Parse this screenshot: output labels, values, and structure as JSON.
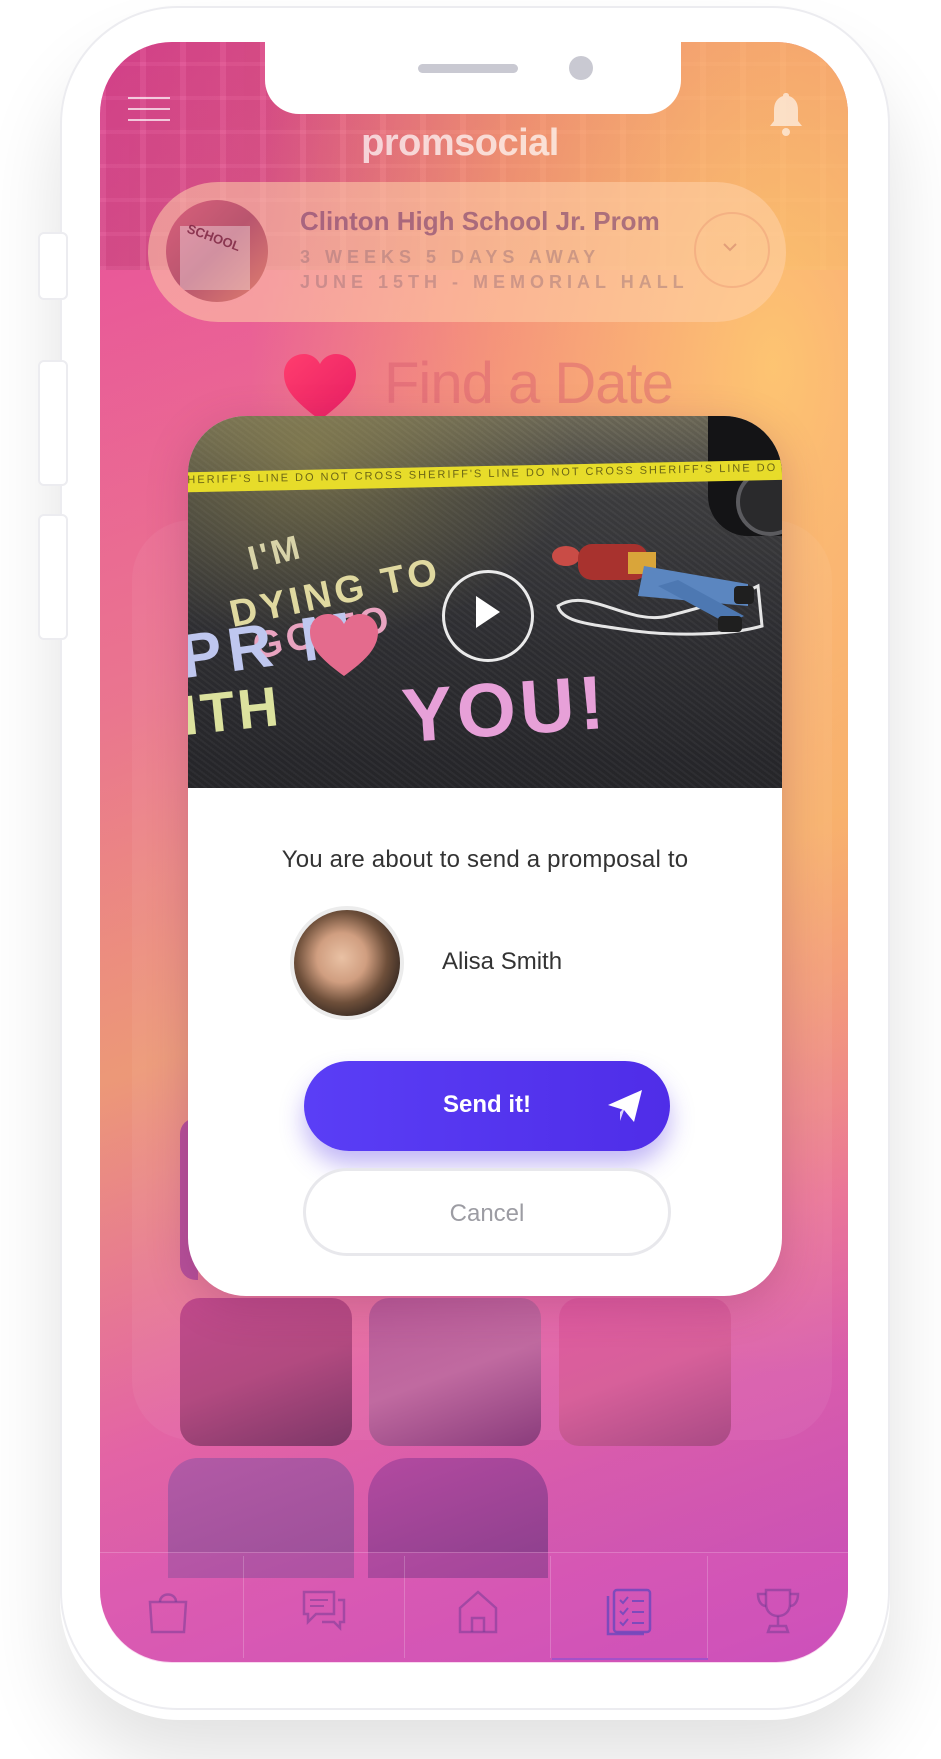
{
  "app": {
    "logo_text": "promsocial"
  },
  "event": {
    "title": "Clinton High School Jr. Prom",
    "countdown": "3 WEEKS  5  DAYS AWAY",
    "details": "JUNE 15TH -  MEMORIAL  HALL",
    "avatar_label": "SCHOOL"
  },
  "page": {
    "heading": "Find a Date"
  },
  "modal": {
    "video_chalk_line1": "I'M",
    "video_chalk_line2": "DYING TO",
    "video_chalk_line3": "GO TO",
    "video_chalk_line4": "PR M",
    "video_chalk_line5": "ITH",
    "video_chalk_line6": "YOU!",
    "tape_text": "SHERIFF'S LINE DO NOT CROSS   SHERIFF'S LINE DO NOT CROSS   SHERIFF'S LINE DO NOT CROSS",
    "prompt": "You are about to send a promposal to",
    "recipient_name": "Alisa Smith",
    "send_label": "Send it!",
    "cancel_label": "Cancel"
  },
  "tabbar": {
    "items": [
      "shop-icon",
      "messages-icon",
      "home-icon",
      "checklist-icon",
      "trophy-icon"
    ],
    "active": "checklist-icon"
  },
  "colors": {
    "send_button": "#5a3ef6",
    "heart": "#f0386e",
    "gradient_pink": "#e8489e",
    "gradient_orange": "#f7a86a"
  }
}
